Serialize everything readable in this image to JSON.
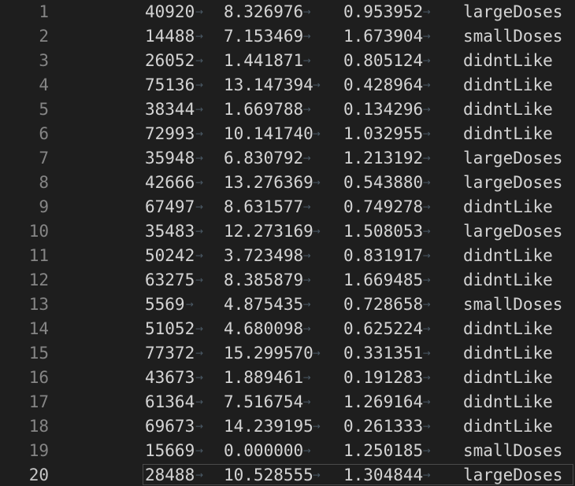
{
  "editor": {
    "tab_arrow": "→",
    "current_line": 20,
    "rows": [
      {
        "line": "1",
        "cells": [
          "40920",
          "8.326976",
          "0.953952",
          "largeDoses"
        ]
      },
      {
        "line": "2",
        "cells": [
          "14488",
          "7.153469",
          "1.673904",
          "smallDoses"
        ]
      },
      {
        "line": "3",
        "cells": [
          "26052",
          "1.441871",
          "0.805124",
          "didntLike"
        ]
      },
      {
        "line": "4",
        "cells": [
          "75136",
          "13.147394",
          "0.428964",
          "didntLike"
        ]
      },
      {
        "line": "5",
        "cells": [
          "38344",
          "1.669788",
          "0.134296",
          "didntLike"
        ]
      },
      {
        "line": "6",
        "cells": [
          "72993",
          "10.141740",
          "1.032955",
          "didntLike"
        ]
      },
      {
        "line": "7",
        "cells": [
          "35948",
          "6.830792",
          "1.213192",
          "largeDoses"
        ]
      },
      {
        "line": "8",
        "cells": [
          "42666",
          "13.276369",
          "0.543880",
          "largeDoses"
        ]
      },
      {
        "line": "9",
        "cells": [
          "67497",
          "8.631577",
          "0.749278",
          "didntLike"
        ]
      },
      {
        "line": "10",
        "cells": [
          "35483",
          "12.273169",
          "1.508053",
          "largeDoses"
        ]
      },
      {
        "line": "11",
        "cells": [
          "50242",
          "3.723498",
          "0.831917",
          "didntLike"
        ]
      },
      {
        "line": "12",
        "cells": [
          "63275",
          "8.385879",
          "1.669485",
          "didntLike"
        ]
      },
      {
        "line": "13",
        "cells": [
          "5569",
          "4.875435",
          "0.728658",
          "smallDoses"
        ]
      },
      {
        "line": "14",
        "cells": [
          "51052",
          "4.680098",
          "0.625224",
          "didntLike"
        ]
      },
      {
        "line": "15",
        "cells": [
          "77372",
          "15.299570",
          "0.331351",
          "didntLike"
        ]
      },
      {
        "line": "16",
        "cells": [
          "43673",
          "1.889461",
          "0.191283",
          "didntLike"
        ]
      },
      {
        "line": "17",
        "cells": [
          "61364",
          "7.516754",
          "1.269164",
          "didntLike"
        ]
      },
      {
        "line": "18",
        "cells": [
          "69673",
          "14.239195",
          "0.261333",
          "didntLike"
        ]
      },
      {
        "line": "19",
        "cells": [
          "15669",
          "0.000000",
          "1.250185",
          "smallDoses"
        ]
      },
      {
        "line": "20",
        "cells": [
          "28488",
          "10.528555",
          "1.304844",
          "largeDoses"
        ]
      }
    ]
  }
}
